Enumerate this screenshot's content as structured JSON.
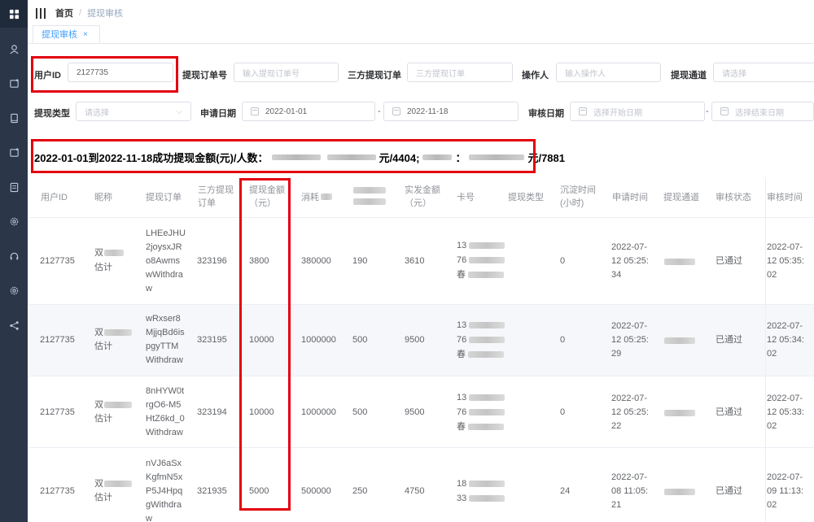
{
  "sidebar": {
    "icons": [
      "dashboard-icon",
      "user-icon",
      "folder-icon",
      "tablet-icon",
      "folder-icon-2",
      "document-icon",
      "gear-icon",
      "headset-icon",
      "settings-icon",
      "share-icon"
    ]
  },
  "header": {
    "breadcrumb_home": "首页",
    "breadcrumb_sep": "/",
    "breadcrumb_current": "提现审核"
  },
  "tabs": [
    {
      "label": "提现审核",
      "close": "×"
    }
  ],
  "filters": {
    "user_id": {
      "label": "用户ID",
      "value": "2127735"
    },
    "order_no": {
      "label": "提现订单号",
      "placeholder": "输入提现订单号"
    },
    "third_order": {
      "label": "三方提现订单",
      "placeholder": "三方提现订单"
    },
    "operator": {
      "label": "操作人",
      "placeholder": "输入操作人"
    },
    "channel": {
      "label": "提现通道",
      "placeholder": "请选择"
    },
    "type": {
      "label": "提现类型",
      "placeholder": "请选择"
    },
    "apply_date": {
      "label": "申请日期",
      "start": "2022-01-01",
      "sep": "-",
      "end": "2022-11-18"
    },
    "audit_date": {
      "label": "审核日期",
      "start_placeholder": "选择开始日期",
      "sep": "-",
      "end_placeholder": "选择结束日期"
    }
  },
  "summary": {
    "prefix": "2022-01-01到2022-11-18成功提现金额(元)/人数：",
    "part1": "元/4404;",
    "colon": "：",
    "part2": "元/7881"
  },
  "table": {
    "columns": [
      "用户ID",
      "昵称",
      "提现订单",
      "三方提现订单",
      "提现金额（元）",
      "消耗",
      "",
      "实发金额（元）",
      "卡号",
      "提现类型",
      "沉淀时间(小时)",
      "申请时间",
      "提现通道",
      "审核状态",
      "审核时间"
    ],
    "header_lines": {
      "third_order": [
        "三方提现",
        "订单"
      ],
      "amount": [
        "提现金额",
        "（元）"
      ],
      "consume": "消耗",
      "actual": [
        "实发金额",
        "（元）"
      ],
      "settle": [
        "沉淀时间",
        "(小时)"
      ]
    },
    "rows": [
      {
        "user_id": "2127735",
        "nick1": "双",
        "nick2": "估计",
        "order": [
          "LHEeJHU",
          "2joysxJR",
          "o8Awms",
          "wWithdra",
          "w"
        ],
        "third": "323196",
        "amount": "3800",
        "consume": "380000",
        "col7": "190",
        "actual": "3610",
        "card": [
          "13",
          "76",
          "春"
        ],
        "settle": "0",
        "apply": [
          "2022-07-",
          "12 05:25:",
          "34"
        ],
        "status": "已通过",
        "audit": [
          "2022-07-",
          "12 05:35:",
          "02"
        ]
      },
      {
        "user_id": "2127735",
        "nick1": "双",
        "nick2": "估计",
        "order": [
          "wRxser8",
          "MjjqBd6is",
          "pgyTTM",
          "Withdraw"
        ],
        "third": "323195",
        "amount": "10000",
        "consume": "1000000",
        "col7": "500",
        "actual": "9500",
        "card": [
          "13",
          "76",
          "春"
        ],
        "settle": "0",
        "apply": [
          "2022-07-",
          "12 05:25:",
          "29"
        ],
        "status": "已通过",
        "audit": [
          "2022-07-",
          "12 05:34:",
          "02"
        ]
      },
      {
        "user_id": "2127735",
        "nick1": "双",
        "nick2": "估计",
        "order": [
          "8nHYW0t",
          "rgO6-M5",
          "HtZ6kd_0",
          "Withdraw"
        ],
        "third": "323194",
        "amount": "10000",
        "consume": "1000000",
        "col7": "500",
        "actual": "9500",
        "card": [
          "13",
          "76",
          "春"
        ],
        "settle": "0",
        "apply": [
          "2022-07-",
          "12 05:25:",
          "22"
        ],
        "status": "已通过",
        "audit": [
          "2022-07-",
          "12 05:33:",
          "02"
        ]
      },
      {
        "user_id": "2127735",
        "nick1": "双",
        "nick2": "估计",
        "order": [
          "nVJ6aSx",
          "KgfmN5x",
          "P5J4Hpq",
          "gWithdra",
          "w"
        ],
        "third": "321935",
        "amount": "5000",
        "consume": "500000",
        "col7": "250",
        "actual": "4750",
        "card": [
          "18",
          "33"
        ],
        "settle": "24",
        "apply": [
          "2022-07-",
          "08 11:05:",
          "21"
        ],
        "status": "已通过",
        "audit": [
          "2022-07-",
          "09 11:13:",
          "02"
        ]
      }
    ]
  },
  "colors": {
    "sidebar": "#2b3649",
    "accent": "#409eff",
    "highlight_box": "#e3000f"
  }
}
